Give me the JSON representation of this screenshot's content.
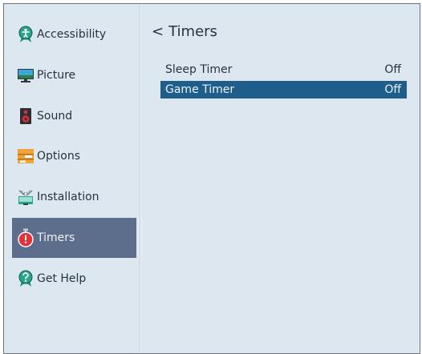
{
  "sidebar": {
    "items": [
      {
        "label": "Accessibility",
        "icon": "accessibility-icon"
      },
      {
        "label": "Picture",
        "icon": "picture-icon"
      },
      {
        "label": "Sound",
        "icon": "speaker-icon"
      },
      {
        "label": "Options",
        "icon": "options-icon"
      },
      {
        "label": "Installation",
        "icon": "antenna-icon"
      },
      {
        "label": "Timers",
        "icon": "stopwatch-icon",
        "selected": true
      },
      {
        "label": "Get Help",
        "icon": "help-icon"
      }
    ]
  },
  "main": {
    "back_symbol": "<",
    "title": "Timers",
    "rows": [
      {
        "label": "Sleep Timer",
        "value": "Off"
      },
      {
        "label": "Game Timer",
        "value": "Off",
        "selected": true
      }
    ]
  },
  "colors": {
    "background": "#dde7f0",
    "sidebar_selected": "#5d6e8c",
    "row_selected": "#1f5e8a"
  }
}
